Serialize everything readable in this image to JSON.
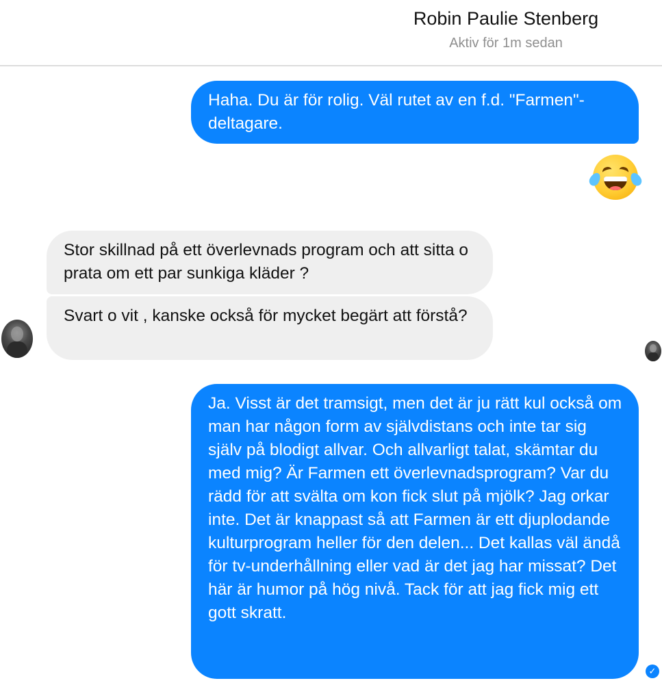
{
  "header": {
    "contact_name": "Robin Paulie Stenberg",
    "status": "Aktiv för 1m sedan"
  },
  "messages": [
    {
      "sender": "me",
      "text": "Haha. Du är för rolig. Väl rutet av en f.d. \"Farmen\"-deltagare."
    },
    {
      "sender": "me",
      "type": "emoji",
      "icon": "face-with-tears-of-joy-icon"
    },
    {
      "sender": "contact",
      "text": "Stor skillnad på ett överlevnads program och att sitta o prata om ett par sunkiga kläder ?"
    },
    {
      "sender": "contact",
      "text": "Svart o vit , kanske också för mycket begärt att förstå?"
    },
    {
      "sender": "me",
      "text": "Ja. Visst är det tramsigt, men det är ju rätt kul också om man har någon form av självdistans och inte tar sig själv på blodigt allvar. Och allvarligt talat, skämtar du med mig? Är Farmen ett överlevnadsprogram? Var du rädd för att svälta om kon fick slut på mjölk? Jag orkar inte. Det är knappast så att Farmen är ett djuplodande kulturprogram heller för den delen... Det kallas väl ändå för tv-underhållning eller vad är det jag har missat? Det här är humor på hög nivå. Tack för att jag fick mig ett gott skratt."
    }
  ],
  "seen_icon": "checkmark-circle-icon",
  "colors": {
    "outgoing_bubble": "#0b84ff",
    "incoming_bubble": "#efefef",
    "status_text": "#8f8f8f"
  }
}
